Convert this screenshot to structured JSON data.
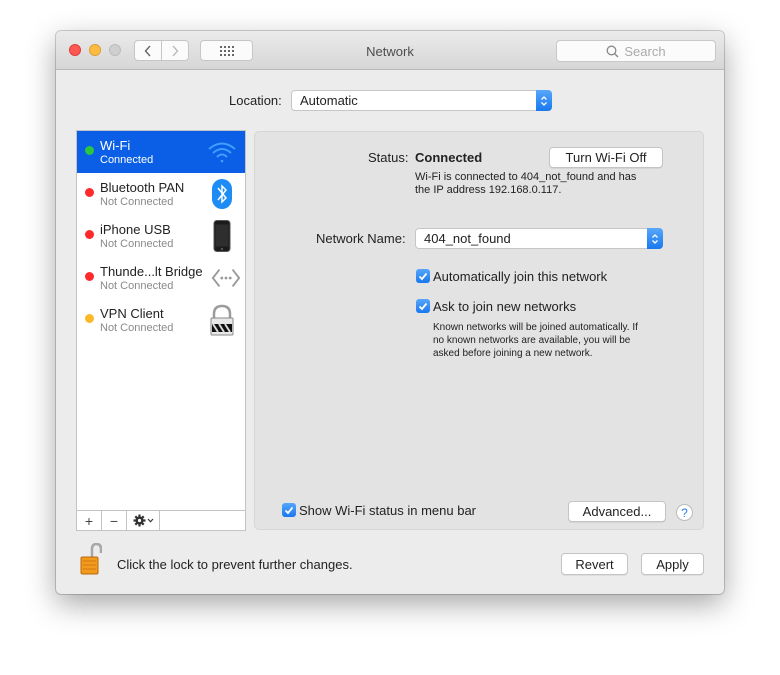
{
  "window": {
    "title": "Network",
    "search_placeholder": "Search"
  },
  "location": {
    "label": "Location:",
    "value": "Automatic"
  },
  "services": [
    {
      "name": "Wi-Fi",
      "status": "Connected",
      "dot_color": "#2ac640",
      "icon": "wifi-icon",
      "selected": true
    },
    {
      "name": "Bluetooth PAN",
      "status": "Not Connected",
      "dot_color": "#fc2a2a",
      "icon": "bluetooth-icon",
      "selected": false
    },
    {
      "name": "iPhone USB",
      "status": "Not Connected",
      "dot_color": "#fc2a2a",
      "icon": "iphone-icon",
      "selected": false
    },
    {
      "name": "Thunde...lt Bridge",
      "status": "Not Connected",
      "dot_color": "#fc2a2a",
      "icon": "thunderbolt-bridge-icon",
      "selected": false
    },
    {
      "name": "VPN Client",
      "status": "Not Connected",
      "dot_color": "#fdb82a",
      "icon": "vpn-lock-icon",
      "selected": false
    }
  ],
  "sidebar_toolbar": {
    "add": "+",
    "remove": "−"
  },
  "detail": {
    "status_label": "Status:",
    "status_value": "Connected",
    "turn_off_button": "Turn Wi-Fi Off",
    "status_desc_line1": "Wi-Fi is connected to 404_not_found and has",
    "status_desc_line2": "the IP address 192.168.0.117.",
    "network_name_label": "Network Name:",
    "network_name_value": "404_not_found",
    "auto_join_label": "Automatically join this network",
    "auto_join_checked": true,
    "ask_join_label": "Ask to join new networks",
    "ask_join_checked": true,
    "ask_desc_line1": "Known networks will be joined automatically. If",
    "ask_desc_line2": "no known networks are available, you will be",
    "ask_desc_line3": "asked before joining a new network.",
    "show_status_label": "Show Wi-Fi status in menu bar",
    "show_status_checked": true,
    "advanced_button": "Advanced...",
    "help": "?"
  },
  "footer": {
    "lock_text": "Click the lock to prevent further changes.",
    "revert_button": "Revert",
    "apply_button": "Apply"
  },
  "colors": {
    "selection": "#0a5fe6",
    "accent": "#1a78ee"
  }
}
